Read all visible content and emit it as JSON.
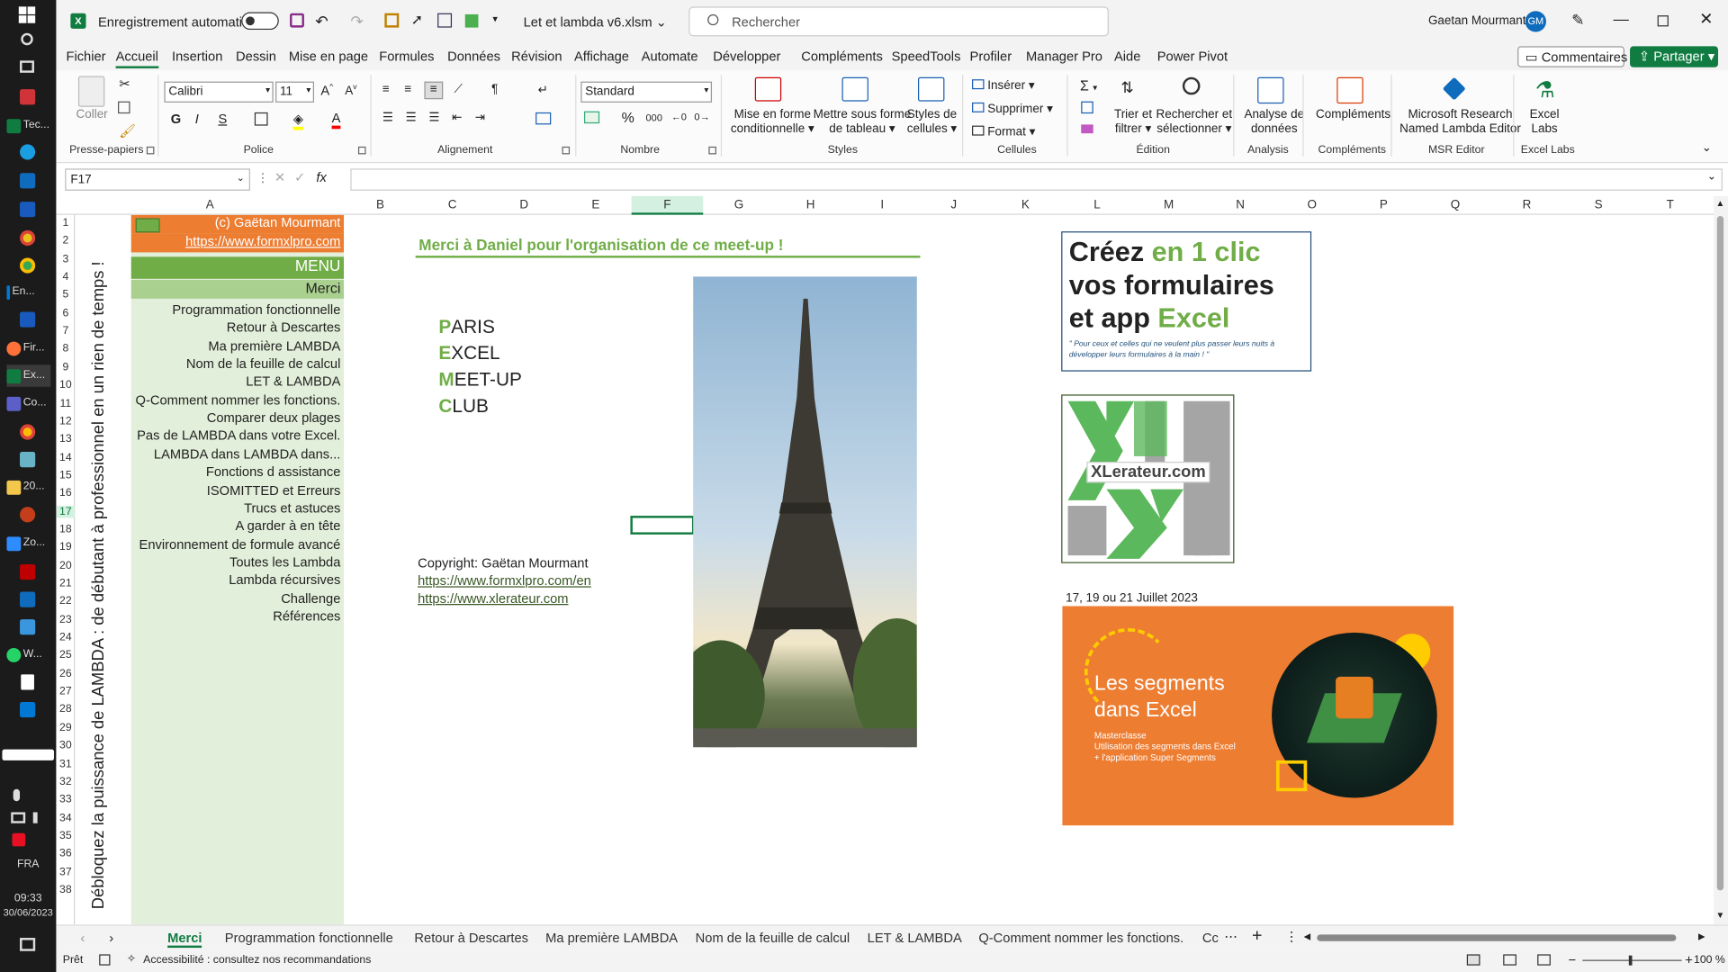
{
  "taskbar": {
    "items": [
      {
        "label": "Tec..."
      },
      {
        "label": "En..."
      },
      {
        "label": "Fir..."
      },
      {
        "label": "Ex..."
      },
      {
        "label": "Co..."
      },
      {
        "label": "20..."
      },
      {
        "label": "Zo..."
      },
      {
        "label": "W..."
      }
    ],
    "lang": "FRA",
    "time": "09:33",
    "date": "30/06/2023"
  },
  "title": {
    "autosave": "Enregistrement automatique",
    "filename": "Let et lambda v6.xlsm",
    "search": "Rechercher",
    "user": "Gaetan Mourmant",
    "initials": "GM"
  },
  "menu": {
    "items": [
      "Fichier",
      "Accueil",
      "Insertion",
      "Dessin",
      "Mise en page",
      "Formules",
      "Données",
      "Révision",
      "Affichage",
      "Automate",
      "Développer",
      "Compléments",
      "SpeedTools",
      "Profiler",
      "Manager Pro",
      "Aide",
      "Power Pivot"
    ],
    "comments": "Commentaires",
    "share": "Partager"
  },
  "ribbon": {
    "paste": "Coller",
    "font": "Calibri",
    "size": "11",
    "format": "Standard",
    "cond": [
      "Mise en forme",
      "conditionnelle"
    ],
    "table": [
      "Mettre sous forme",
      "de tableau"
    ],
    "styles": [
      "Styles de",
      "cellules"
    ],
    "insert": "Insérer",
    "delete": "Supprimer",
    "fmt": "Format",
    "sort": [
      "Trier et",
      "filtrer"
    ],
    "find": [
      "Rechercher et",
      "sélectionner"
    ],
    "analysis": [
      "Analyse de",
      "données"
    ],
    "addins": "Compléments",
    "msr": [
      "Microsoft Research",
      "Named Lambda Editor"
    ],
    "labs": [
      "Excel",
      "Labs"
    ],
    "groups": [
      "Presse-papiers",
      "Police",
      "Alignement",
      "Nombre",
      "Styles",
      "Cellules",
      "Édition",
      "Analysis",
      "Compléments",
      "MSR Editor",
      "Excel Labs"
    ]
  },
  "formula": {
    "cell": "F17",
    "fx": "fx"
  },
  "columns": [
    "A",
    "B",
    "C",
    "D",
    "E",
    "F",
    "G",
    "H",
    "I",
    "J",
    "K",
    "L",
    "M",
    "N",
    "O",
    "P",
    "Q",
    "R",
    "S",
    "T"
  ],
  "rows": [
    "1",
    "2",
    "3",
    "4",
    "5",
    "6",
    "7",
    "8",
    "9",
    "10",
    "11",
    "12",
    "13",
    "14",
    "15",
    "16",
    "17",
    "18",
    "19",
    "20",
    "21",
    "22",
    "23",
    "24",
    "25",
    "26",
    "27",
    "28",
    "29",
    "30",
    "31",
    "32",
    "33",
    "34",
    "35",
    "36",
    "37",
    "38"
  ],
  "sheet": {
    "vertical": "Débloquez la puissance de LAMBDA : de débutant à professionnel en un rien de temps !",
    "copyright_a1": "(c) Gaëtan Mourmant",
    "url_a2": "https://www.formxlpro.com",
    "menu_title": "MENU",
    "merci": "Merci",
    "menu_items": [
      "Programmation fonctionnelle",
      "Retour à Descartes",
      "Ma première LAMBDA",
      "Nom de la feuille de calcul",
      "LET & LAMBDA",
      "Q-Comment nommer les fonctions.",
      "Comparer deux plages",
      "Pas de LAMBDA dans votre Excel.",
      "LAMBDA dans LAMBDA dans...",
      "Fonctions d assistance",
      "ISOMITTED et Erreurs",
      "Trucs et astuces",
      "A garder à en tête",
      "Environnement de formule avancé",
      "Toutes les Lambda",
      "Lambda récursives",
      "Challenge",
      "Références"
    ],
    "thanks": "Merci à Daniel pour l'organisation de ce meet-up !",
    "pemc": [
      {
        "first": "P",
        "rest": "ARIS"
      },
      {
        "first": "E",
        "rest": "XCEL"
      },
      {
        "first": "M",
        "rest": "EET-UP"
      },
      {
        "first": "C",
        "rest": "LUB"
      }
    ],
    "copyright": "Copyright: Gaëtan Mourmant",
    "link1": "https://www.formxlpro.com/en",
    "link2": "https://www.xlerateur.com",
    "ad1": {
      "l1a": "Créez ",
      "l1b": "en 1 clic",
      "l2": "vos formulaires",
      "l3a": "et app ",
      "l3b": "Excel",
      "sub": "\" Pour ceux et celles qui ne veulent plus passer leurs nuits à développer leurs formulaires à la main ! \""
    },
    "logo2": "XLerateur.com",
    "date_text": "17, 19 ou 21 Juillet 2023",
    "ad3": {
      "title1": "Les segments",
      "title2": "dans Excel",
      "sub1": "Masterclasse",
      "sub2": "Utilisation des segments dans Excel",
      "sub3": "+ l'application Super Segments"
    }
  },
  "sheettabs": [
    "Merci",
    "Programmation fonctionnelle",
    "Retour à Descartes",
    "Ma première LAMBDA",
    "Nom de la feuille de calcul",
    "LET & LAMBDA",
    "Q-Comment nommer les fonctions.",
    "Cc"
  ],
  "status": {
    "ready": "Prêt",
    "access": "Accessibilité : consultez nos recommandations",
    "zoom": "100 %"
  },
  "colors": {
    "excel_green": "#107c41",
    "orange": "#ed7d31",
    "menu_green": "#70ad47",
    "light_green": "#e2efda"
  }
}
